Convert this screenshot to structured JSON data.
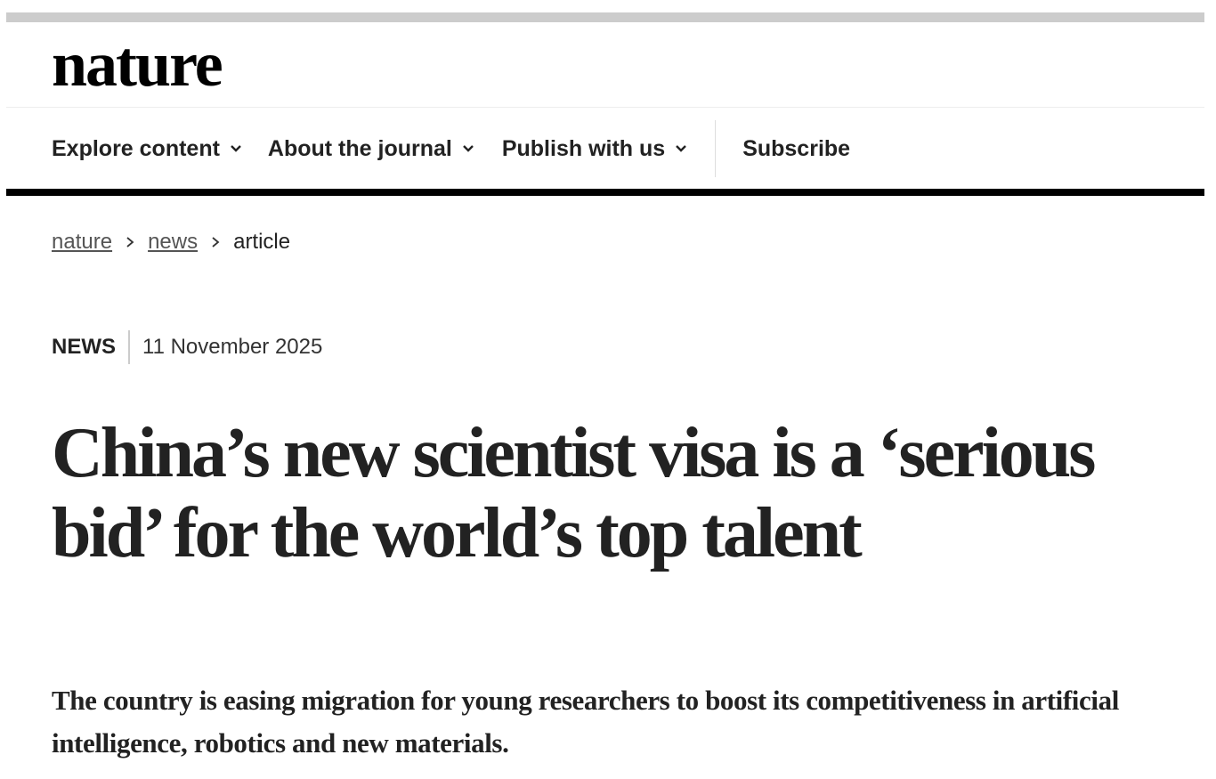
{
  "header": {
    "logo_text": "nature"
  },
  "nav": {
    "items": [
      {
        "label": "Explore content",
        "icon": "chevron-down-icon"
      },
      {
        "label": "About the journal",
        "icon": "chevron-down-icon"
      },
      {
        "label": "Publish with us",
        "icon": "chevron-down-icon"
      },
      {
        "label": "Subscribe"
      }
    ]
  },
  "breadcrumb": {
    "items": [
      {
        "label": "nature"
      },
      {
        "label": "news"
      },
      {
        "label": "article"
      }
    ]
  },
  "article": {
    "type": "NEWS",
    "date": "11 November 2025",
    "title": "China’s new scientist visa is a ‘serious bid’ for the world’s top talent",
    "standfirst": "The country is easing migration for young researchers to boost its competitiveness in artificial intelligence, robotics and new materials."
  },
  "colors": {
    "text": "#222222",
    "rule": "#000000",
    "top_strip": "#cccccc",
    "link": "#555555"
  }
}
